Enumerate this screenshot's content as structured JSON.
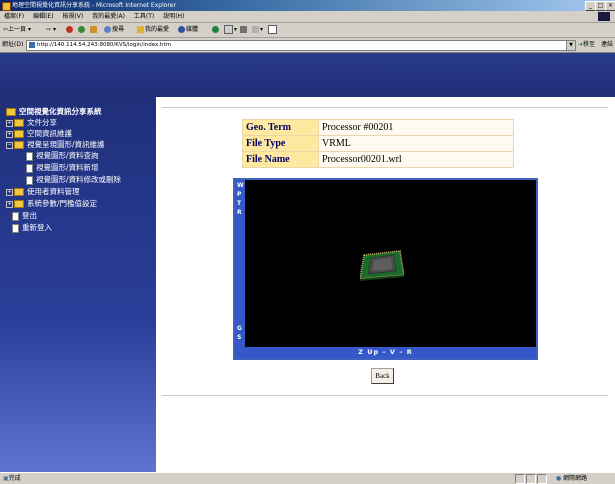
{
  "window": {
    "title": "地理空間視覺化資訊分享系統 - Microsoft Internet Explorer",
    "min": "_",
    "max": "□",
    "close": "×"
  },
  "menu": [
    "檔案(F)",
    "編輯(E)",
    "檢視(V)",
    "我的最愛(A)",
    "工具(T)",
    "說明(H)"
  ],
  "toolbar": {
    "back": "上一頁",
    "search": "搜尋",
    "favorites": "我的最愛",
    "media": "媒體"
  },
  "address": {
    "label": "網址(D)",
    "url": "http://140.114.54.243:8080/KVS/login/index.htm",
    "go": "移至",
    "links": "連結"
  },
  "sidebar": {
    "root": "空間視覺化資訊分享系統",
    "items": [
      {
        "label": "文件分享"
      },
      {
        "label": "空間資訊維護"
      },
      {
        "label": "視覺呈現圖形/資訊維護"
      },
      {
        "label": "視覺圖形/資料查詢"
      },
      {
        "label": "視覺圖形/資料新增"
      },
      {
        "label": "視覺圖形/資料修改或刪除"
      },
      {
        "label": "使用者資料管理"
      },
      {
        "label": "系統參數/門檻值設定"
      },
      {
        "label": "登出"
      },
      {
        "label": "重新登入"
      }
    ]
  },
  "details": [
    {
      "key": "Geo. Term",
      "value": "Processor #00201"
    },
    {
      "key": "File Type",
      "value": "VRML"
    },
    {
      "key": "File Name",
      "value": "Processor00201.wrl"
    }
  ],
  "viewer": {
    "side_letters": [
      "W",
      "P",
      "T",
      "R",
      "G",
      "S"
    ],
    "controls": "Z  Up  –  V  –  R"
  },
  "back_button": "Back",
  "status": {
    "text": "完成",
    "zone": "網際網路"
  },
  "colors": {
    "sidebar_bg": "#1f2f7a",
    "header_band": "#2b3c8a",
    "table_key_bg": "#ffe8a0",
    "viewer_frame": "#3458c8"
  }
}
